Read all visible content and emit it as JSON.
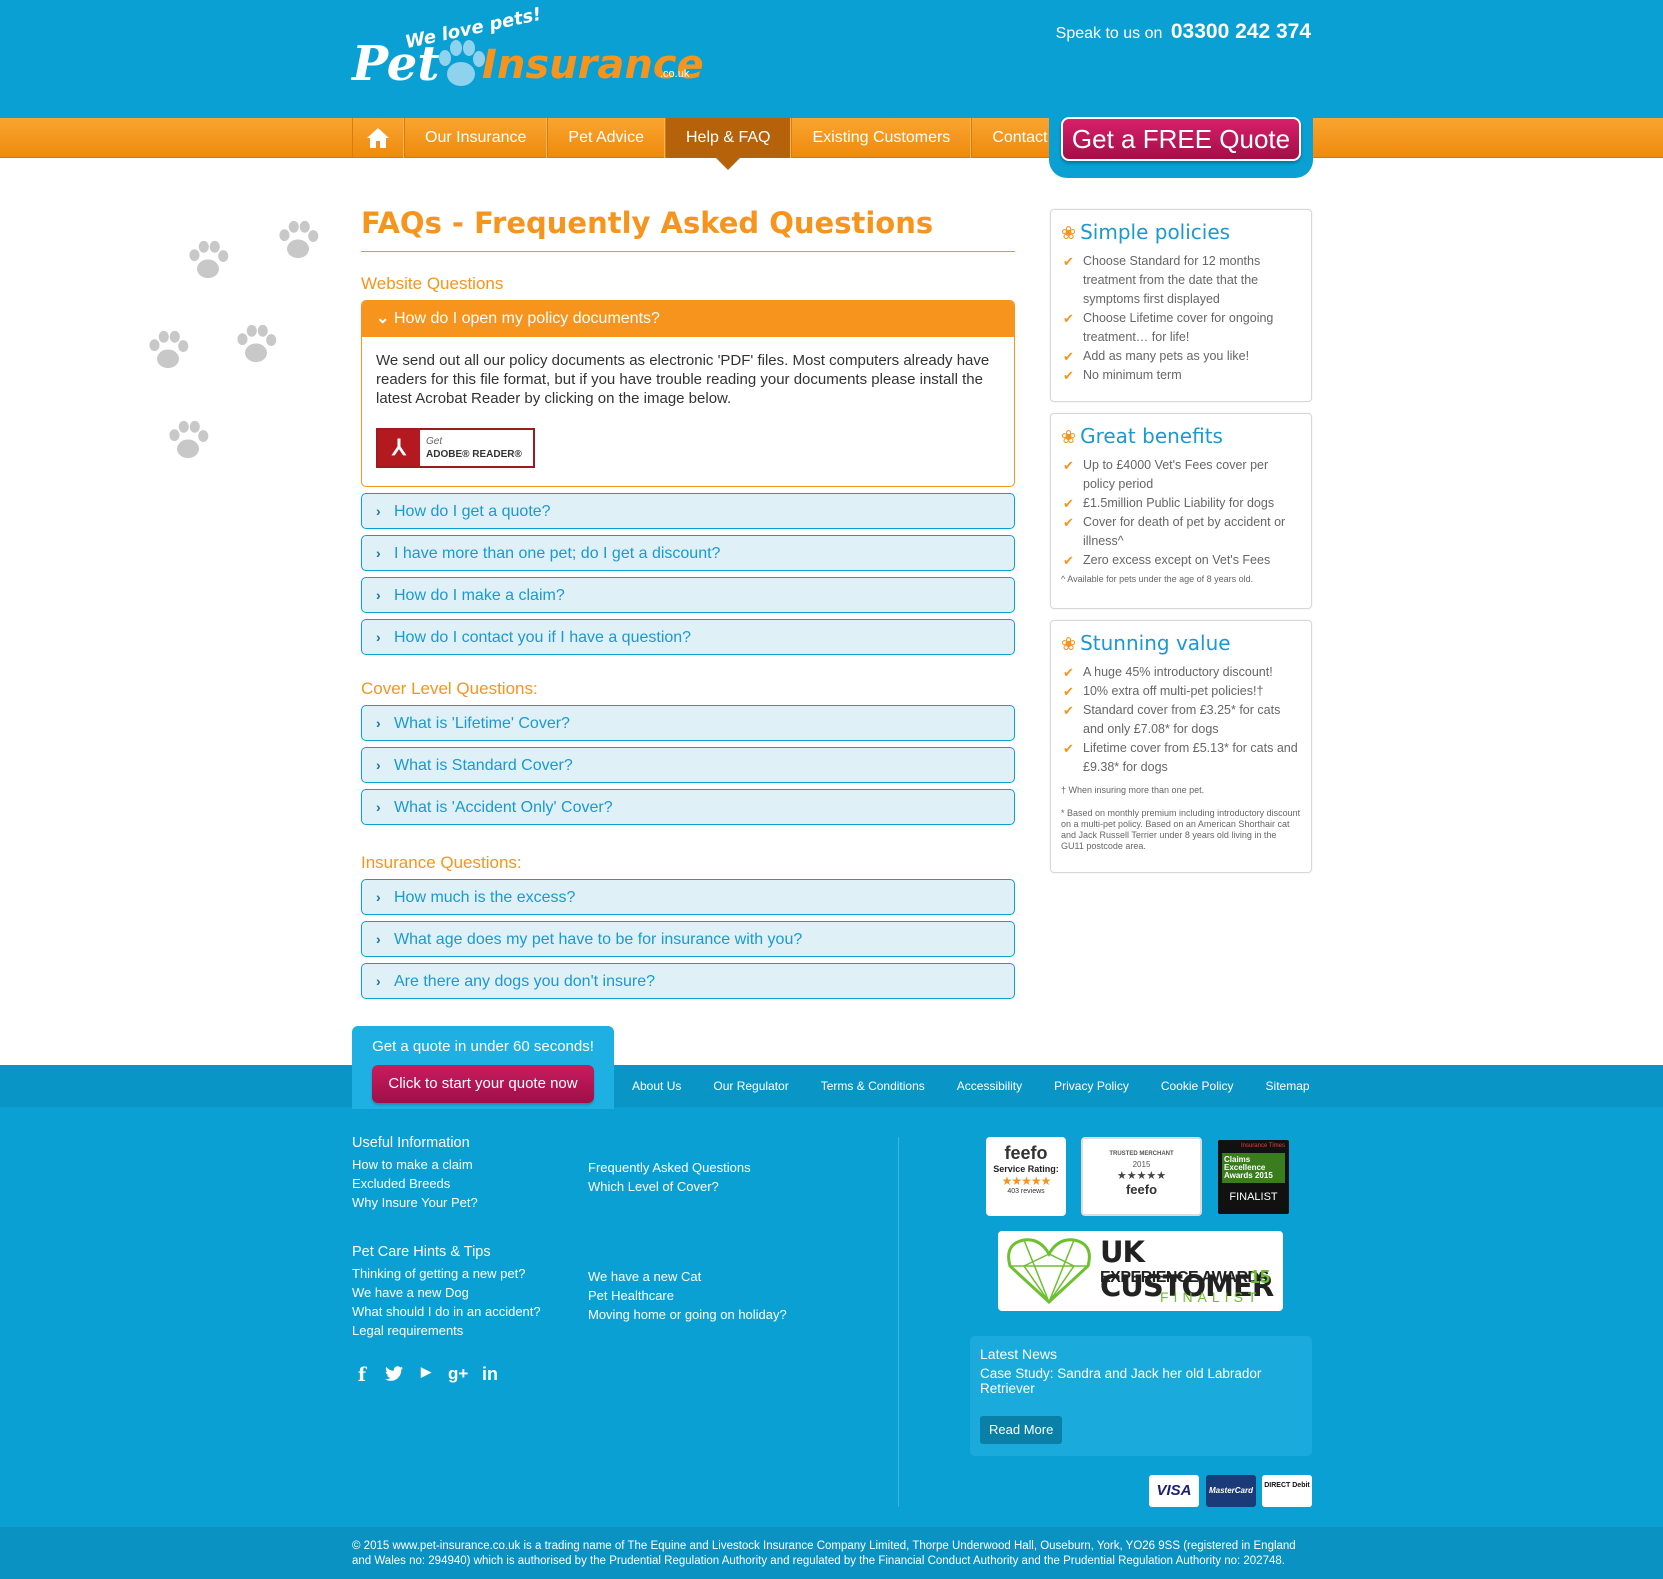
{
  "header": {
    "tagline": "We love pets!",
    "logo_pet": "Pet",
    "logo_insurance": "Insurance",
    "logo_suffix": ".co.uk",
    "speak_label": "Speak to us on",
    "phone": "03300 242 374"
  },
  "nav": {
    "home_icon": "home-icon",
    "items": [
      "Our Insurance",
      "Pet Advice",
      "Help & FAQ",
      "Existing Customers",
      "Contact"
    ],
    "active": "Help & FAQ",
    "quote_button": "Get a FREE Quote"
  },
  "main": {
    "title": "FAQs - Frequently Asked Questions",
    "sections": [
      {
        "title": "Website Questions",
        "open_question": "How do I open my policy documents?",
        "open_answer": "We send out all our policy documents as electronic 'PDF' files. Most computers already have readers for this file format, but if you have trouble reading your documents please install the latest Acrobat Reader by clicking on the image below.",
        "adobe_get": "Get",
        "adobe_reader": "ADOBE® READER®",
        "questions": [
          "How do I get a quote?",
          "I have more than one pet; do I get a discount?",
          "How do I make a claim?",
          "How do I contact you if I have a question?"
        ]
      },
      {
        "title": "Cover Level Questions:",
        "questions": [
          "What is 'Lifetime' Cover?",
          "What is Standard Cover?",
          "What is 'Accident Only' Cover?"
        ]
      },
      {
        "title": "Insurance Questions:",
        "questions": [
          "How much is the excess?",
          "What age does my pet have to be for insurance with you?",
          "Are there any dogs you don't insure?"
        ]
      }
    ]
  },
  "sidebar": {
    "simple": {
      "title": "Simple policies",
      "items": [
        "Choose Standard for 12 months treatment from the date that the symptoms first displayed",
        "Choose Lifetime cover for ongoing treatment… for life!",
        "Add as many pets as you like!",
        "No minimum term"
      ]
    },
    "benefits": {
      "title": "Great benefits",
      "items": [
        "Up to £4000 Vet's Fees cover per policy period",
        "£1.5million Public Liability for dogs",
        "Cover for death of pet by accident or illness^",
        "Zero excess except on Vet's Fees"
      ],
      "note": "^ Available for pets under the age of 8 years old."
    },
    "value": {
      "title": "Stunning value",
      "items": [
        "A huge 45% introductory discount!",
        "10% extra off multi-pet policies!†",
        "Standard cover from £3.25* for cats and only £7.08* for dogs",
        "Lifetime cover from £5.13* for cats and £9.38* for dogs"
      ],
      "note1": "† When insuring more than one pet.",
      "note2": "* Based on monthly premium including introductory discount on a multi-pet policy. Based on an American Shorthair cat and Jack Russell Terrier under 8 years old living in the GU11 postcode area."
    }
  },
  "footer": {
    "quote_title": "Get a quote in under 60 seconds!",
    "quote_button": "Click to start your quote now",
    "links": [
      "About Us",
      "Our Regulator",
      "Terms & Conditions",
      "Accessibility",
      "Privacy Policy",
      "Cookie Policy",
      "Sitemap"
    ],
    "useful": {
      "title": "Useful Information",
      "col1": [
        "How to make a claim",
        "Excluded Breeds",
        "Why Insure Your Pet?"
      ],
      "col2": [
        "Frequently Asked Questions",
        "Which Level of Cover?"
      ]
    },
    "tips": {
      "title": "Pet Care Hints & Tips",
      "col1": [
        "Thinking of getting a new pet?",
        "We have a new Dog",
        "What should I do in an accident?",
        "Legal requirements"
      ],
      "col2": [
        "We have a new Cat",
        "Pet Healthcare",
        "Moving home or going on holiday?"
      ]
    },
    "social": [
      "f",
      "t",
      "yt",
      "g+",
      "in"
    ],
    "badges": {
      "feefo1_title": "feefo",
      "feefo1_sub": "Service Rating:",
      "feefo1_reviews": "403 reviews",
      "feefo2_top": "TRUSTED MERCHANT",
      "feefo2_year": "2015",
      "feefo2_name": "feefo",
      "times_top": "Insurance Times",
      "times_mid": "Claims Excellence Awards 2015",
      "times_bottom": "FINALIST",
      "ukcx_1": "UK CUSTOMER",
      "ukcx_2": "EXPERIENCE AWARDS",
      "ukcx_year": "15",
      "ukcx_3": "FINALIST"
    },
    "news": {
      "title": "Latest News",
      "story": "Case Study: Sandra and Jack her old Labrador Retriever",
      "button": "Read More"
    },
    "payments": [
      "VISA",
      "MasterCard",
      "DIRECT Debit"
    ],
    "copyright": "© 2015 www.pet-insurance.co.uk is a trading name of The Equine and Livestock Insurance Company Limited, Thorpe Underwood Hall, Ouseburn, York, YO26 9SS (registered in England and Wales no: 294940) which is authorised by the Prudential Regulation Authority and regulated by the Financial Conduct Authority and the Prudential Regulation Authority no: 202748."
  }
}
